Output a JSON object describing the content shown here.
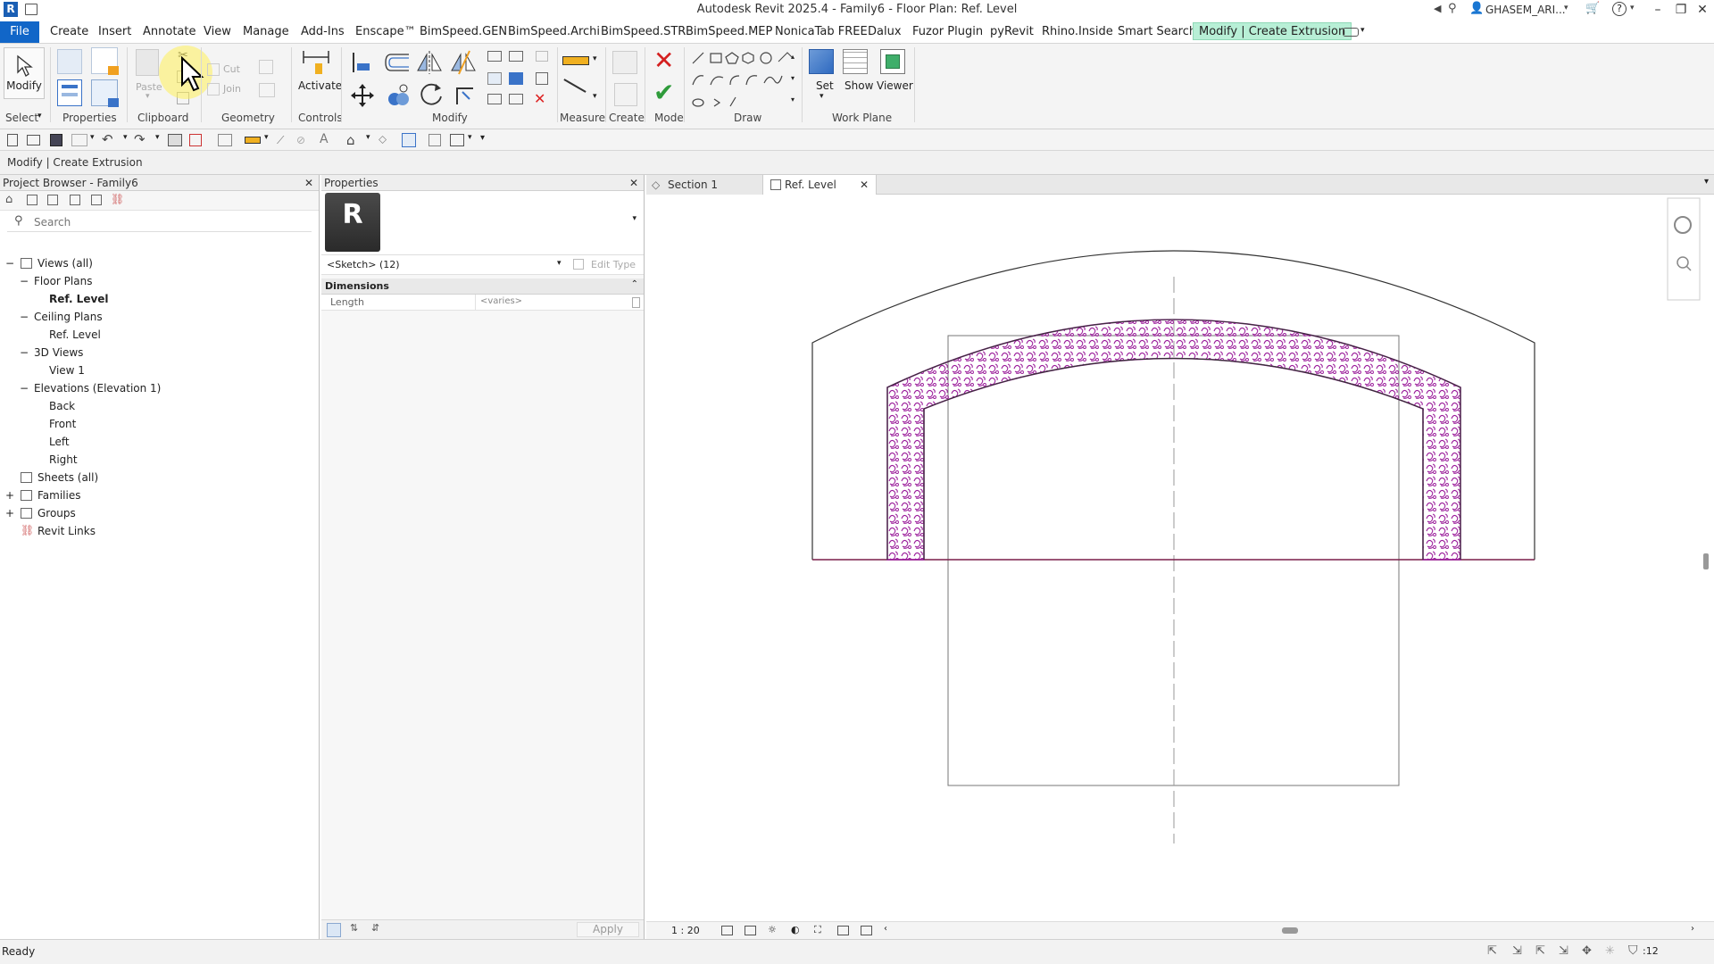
{
  "titlebar": {
    "title": "Autodesk Revit 2025.4 - Family6 - Floor Plan: Ref. Level",
    "user": "GHASEM_ARI...",
    "help": "?"
  },
  "menu": {
    "file": "File",
    "items": [
      "Create",
      "Insert",
      "Annotate",
      "View",
      "Manage",
      "Add-Ins",
      "Enscape™",
      "BimSpeed.GEN",
      "BimSpeed.Archi",
      "BimSpeed.STR",
      "BimSpeed.MEP",
      "NonicaTab FREE",
      "Dalux",
      "Fuzor Plugin",
      "pyRevit",
      "Rhino.Inside",
      "Smart Search"
    ],
    "context_tab": "Modify | Create Extrusion"
  },
  "ribbon": {
    "panels": {
      "select": "Select",
      "properties": "Properties",
      "clipboard": "Clipboard",
      "geometry": "Geometry",
      "controls": "Controls",
      "modify": "Modify",
      "measure": "Measure",
      "create": "Create",
      "mode": "Mode",
      "draw": "Draw",
      "work_plane": "Work Plane"
    },
    "buttons": {
      "modify": "Modify",
      "paste": "Paste",
      "cut": "Cut",
      "join": "Join",
      "activate": "Activate",
      "set": "Set",
      "show": "Show",
      "viewer": "Viewer"
    }
  },
  "options_bar": {
    "text": "Modify | Create Extrusion"
  },
  "project_browser": {
    "title": "Project Browser - Family6",
    "search_placeholder": "Search",
    "tree": [
      {
        "label": "Views (all)",
        "bold": false
      },
      {
        "label": "Floor Plans",
        "bold": false
      },
      {
        "label": "Ref. Level",
        "bold": true
      },
      {
        "label": "Ceiling Plans",
        "bold": false
      },
      {
        "label": "Ref. Level",
        "bold": false
      },
      {
        "label": "3D Views",
        "bold": false
      },
      {
        "label": "View 1",
        "bold": false
      },
      {
        "label": "Elevations (Elevation 1)",
        "bold": false
      },
      {
        "label": "Back",
        "bold": false
      },
      {
        "label": "Front",
        "bold": false
      },
      {
        "label": "Left",
        "bold": false
      },
      {
        "label": "Right",
        "bold": false
      },
      {
        "label": "Sheets (all)",
        "bold": false
      },
      {
        "label": "Families",
        "bold": false
      },
      {
        "label": "Groups",
        "bold": false
      },
      {
        "label": "Revit Links",
        "bold": false
      }
    ]
  },
  "properties": {
    "title": "Properties",
    "selector": "<Sketch> (12)",
    "edit_type": "Edit Type",
    "section": "Dimensions",
    "rows": [
      {
        "name": "Length",
        "value": "<varies>"
      }
    ],
    "apply": "Apply"
  },
  "view_tabs": [
    {
      "label": "Section 1",
      "active": false
    },
    {
      "label": "Ref. Level",
      "active": true
    }
  ],
  "view_bar": {
    "scale": "1 : 20"
  },
  "status": {
    "text": "Ready",
    "filter_count": ":12"
  },
  "colors": {
    "accent_blue": "#1166c8",
    "context_tab": "#b8efd6",
    "ornament": "#9b1d9b",
    "sketch_line": "#7a1f4a"
  }
}
